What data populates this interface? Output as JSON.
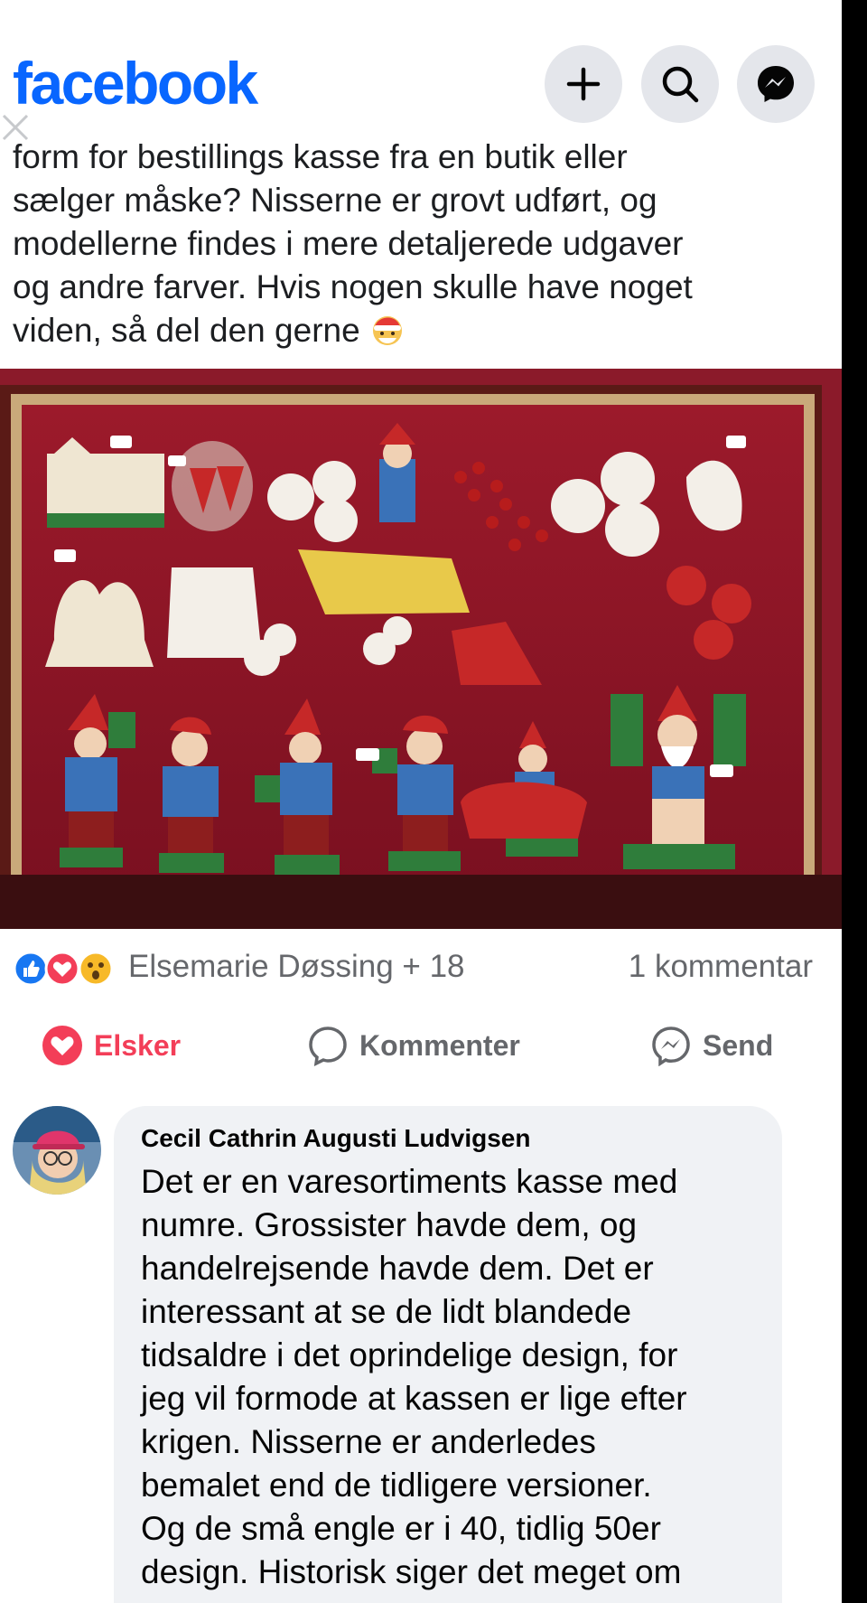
{
  "header": {
    "logo": "facebook",
    "icons": [
      "plus-icon",
      "search-icon",
      "messenger-icon"
    ]
  },
  "post": {
    "text_lines": [
      "form for bestillings kasse fra en butik eller",
      "sælger måske? Nisserne er grovt udført, og",
      "modellerne findes i mere detaljerede udgaver",
      "og andre farver. Hvis nogen skulle have noget",
      "viden, så del den gerne"
    ],
    "emoji": "santa-emoji-icon"
  },
  "reactions": {
    "icons": [
      "like-icon",
      "love-icon",
      "wow-icon"
    ],
    "names": "Elsemarie Døssing + 18",
    "comment_count": "1 kommentar"
  },
  "actions": {
    "love_label": "Elsker",
    "comment_label": "Kommenter",
    "send_label": "Send"
  },
  "comment": {
    "author": "Cecil Cathrin Augusti Ludvigsen",
    "text_lines": [
      "Det er en varesortiments kasse med",
      "numre. Grossister havde dem, og",
      "handelrejsende havde dem. Det er",
      "interessant at se de lidt blandede",
      "tidsaldre i det oprindelige design, for",
      "jeg vil formode at kassen er lige efter",
      "krigen. Nisserne er anderledes",
      "bemalet end de tidligere versioner.",
      "Og de små engle er i 40, tidlig 50er",
      "design. Historisk siger det meget om"
    ]
  },
  "colors": {
    "brand": "#0866ff",
    "love": "#f33e58",
    "muted": "#65676b",
    "bubble": "#f0f2f5"
  }
}
